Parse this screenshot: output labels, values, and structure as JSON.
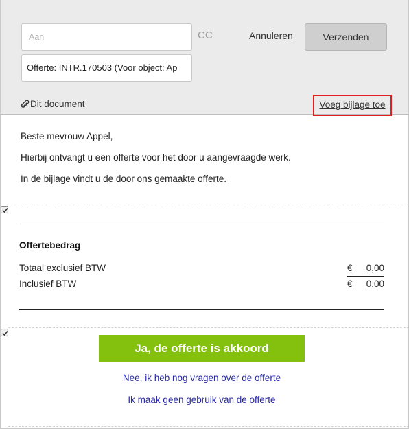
{
  "compose": {
    "to_placeholder": "Aan",
    "cc_label": "CC",
    "subject_value": "Offerte: INTR.170503  (Voor object: Ap",
    "cancel_label": "Annuleren",
    "send_label": "Verzenden",
    "document_link": "Dit document",
    "add_attachment_link": "Voeg bijlage toe"
  },
  "message": {
    "greeting": "Beste mevrouw Appel,",
    "line1": "Hierbij ontvangt u een offerte voor het door u aangevraagde werk.",
    "line2": "In de bijlage vindt u de door ons gemaakte offerte."
  },
  "quote": {
    "title": "Offertebedrag",
    "rows": [
      {
        "label": "Totaal exclusief BTW",
        "currency": "€",
        "value": "0,00"
      },
      {
        "label": "Inclusief BTW",
        "currency": "€",
        "value": "0,00"
      }
    ]
  },
  "actions": {
    "accept_label": "Ja, de offerte is akkoord",
    "questions_link": "Nee, ik heb nog vragen over de offerte",
    "decline_link": "Ik maak geen gebruik van de offerte"
  },
  "colors": {
    "accent_green": "#84c10f",
    "link_blue": "#2a2aa6",
    "highlight_red": "#e02020",
    "header_bg": "#ebebeb"
  },
  "icons": [
    "paperclip-icon",
    "checkbox-checked-icon"
  ]
}
